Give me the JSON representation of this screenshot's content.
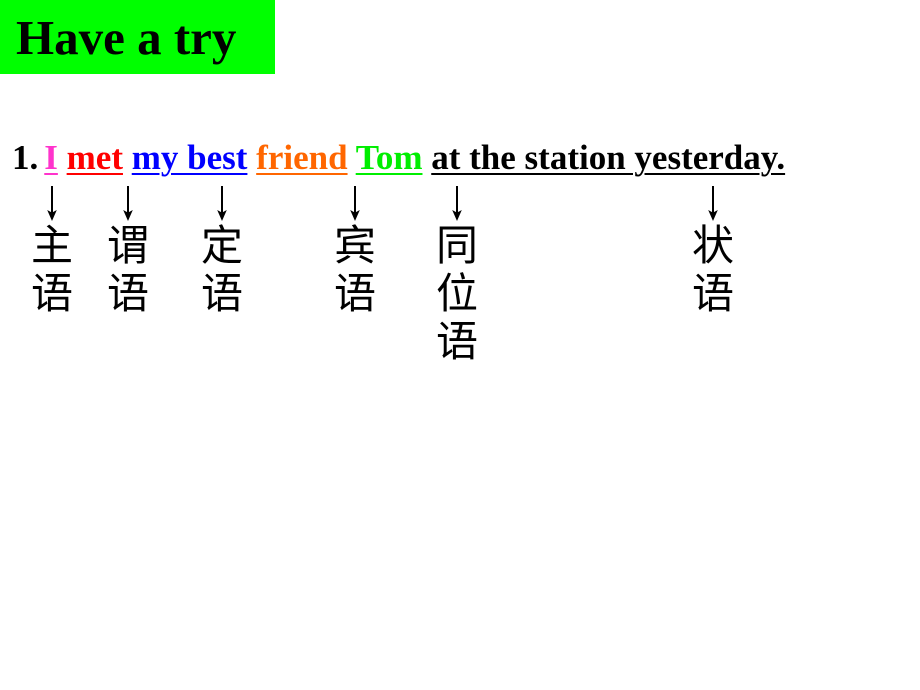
{
  "slide": {
    "title": "Have a try",
    "title_bg_color": "#00ff00",
    "title_text_color": "#000000",
    "background_color": "#ffffff"
  },
  "exercise": {
    "number": "1.",
    "sentence_segments": [
      {
        "text": "I",
        "color": "#ff33cc",
        "underline": true,
        "label_lines": [
          "主",
          "语"
        ]
      },
      {
        "text": "met",
        "color": "#ff0000",
        "underline": true,
        "label_lines": [
          "谓",
          "语"
        ]
      },
      {
        "text": "my best",
        "color": "#0000ff",
        "underline": true,
        "label_lines": [
          "定",
          "语"
        ]
      },
      {
        "text": "friend",
        "color": "#ff6600",
        "underline": true,
        "label_lines": [
          "宾",
          "语"
        ]
      },
      {
        "text": "Tom",
        "color": "#00ee00",
        "underline": true,
        "label_lines": [
          "同",
          "位",
          "语"
        ]
      },
      {
        "text": "at the station yesterday.",
        "color": "#000000",
        "underline": true,
        "label_lines": [
          "状",
          "语"
        ]
      }
    ],
    "full_sentence": "I met my best friend Tom at the station yesterday.",
    "arrow_glyph": "↓",
    "arrow_color": "#000000"
  }
}
